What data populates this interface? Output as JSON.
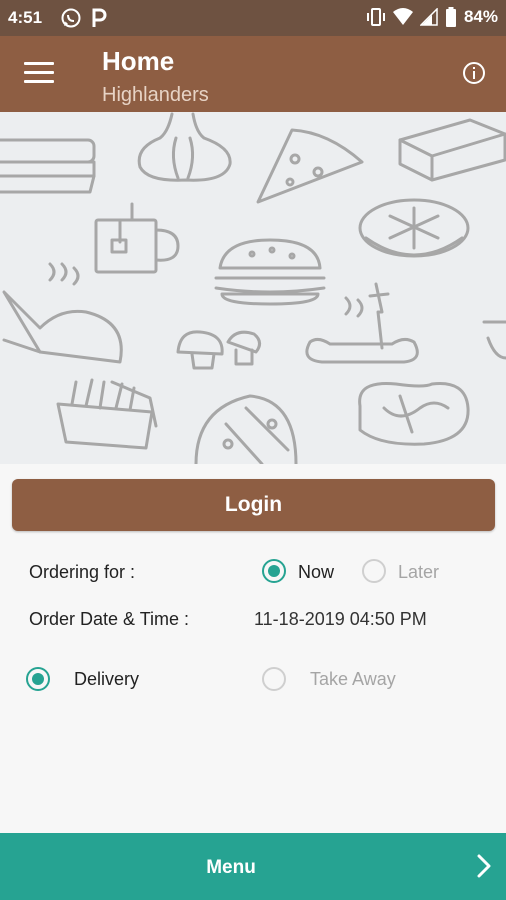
{
  "status_bar": {
    "time": "4:51",
    "battery": "84%",
    "left_icons": [
      "whatsapp-icon",
      "p-app-icon"
    ],
    "right_icons": [
      "vibrate-icon",
      "wifi-icon",
      "signal-icon",
      "battery-icon"
    ]
  },
  "app_bar": {
    "title": "Home",
    "subtitle": "Highlanders",
    "menu_icon": "hamburger-menu-icon",
    "info_icon": "info-icon"
  },
  "hero": {
    "illustration_icons": [
      "burger-icon",
      "garlic-icon",
      "pizza-slice-icon",
      "cake-icon",
      "mug-icon",
      "pie-icon",
      "roast-chicken-icon",
      "mushroom-icon",
      "sausage-icon",
      "fries-icon",
      "pizza-icon",
      "pretzel-icon"
    ]
  },
  "login": {
    "label": "Login"
  },
  "ordering": {
    "label": "Ordering for :",
    "options": [
      "Now",
      "Later"
    ],
    "selected": "Now"
  },
  "order_time": {
    "label": "Order Date & Time :",
    "value": "11-18-2019 04:50 PM"
  },
  "order_type": {
    "options": [
      "Delivery",
      "Take Away"
    ],
    "selected": "Delivery"
  },
  "bottom_bar": {
    "label": "Menu",
    "icon": "chevron-right-icon"
  },
  "colors": {
    "brown": "#8e5e43",
    "dark_brown": "#6e5241",
    "teal": "#26a392",
    "hero_bg": "#eceef0"
  }
}
